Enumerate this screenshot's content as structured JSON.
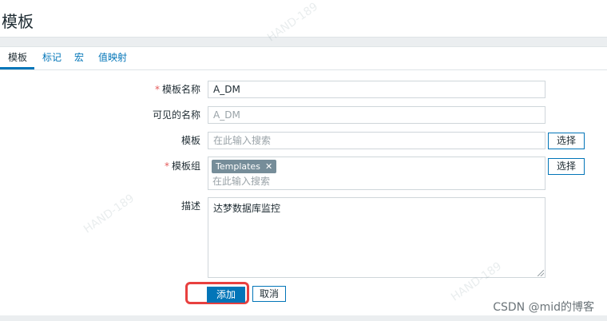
{
  "page": {
    "title": "模板"
  },
  "tabs": [
    {
      "label": "模板",
      "active": true
    },
    {
      "label": "标记",
      "active": false
    },
    {
      "label": "宏",
      "active": false
    },
    {
      "label": "值映射",
      "active": false
    }
  ],
  "form": {
    "template_name": {
      "label": "模板名称",
      "required": true,
      "value": "A_DM"
    },
    "visible_name": {
      "label": "可见的名称",
      "placeholder": "A_DM"
    },
    "templates": {
      "label": "模板",
      "placeholder": "在此输入搜索",
      "select_label": "选择"
    },
    "template_groups": {
      "label": "模板组",
      "required": true,
      "tag": "Templates",
      "placeholder": "在此输入搜索",
      "select_label": "选择"
    },
    "description": {
      "label": "描述",
      "value": "达梦数据库监控"
    }
  },
  "actions": {
    "add_label": "添加",
    "cancel_label": "取消"
  },
  "watermark": {
    "text": "HAND-189",
    "footer": "CSDN @mid的博客"
  },
  "colors": {
    "accent": "#0275b8",
    "highlight": "#e8403f",
    "tag_bg": "#768d99"
  }
}
